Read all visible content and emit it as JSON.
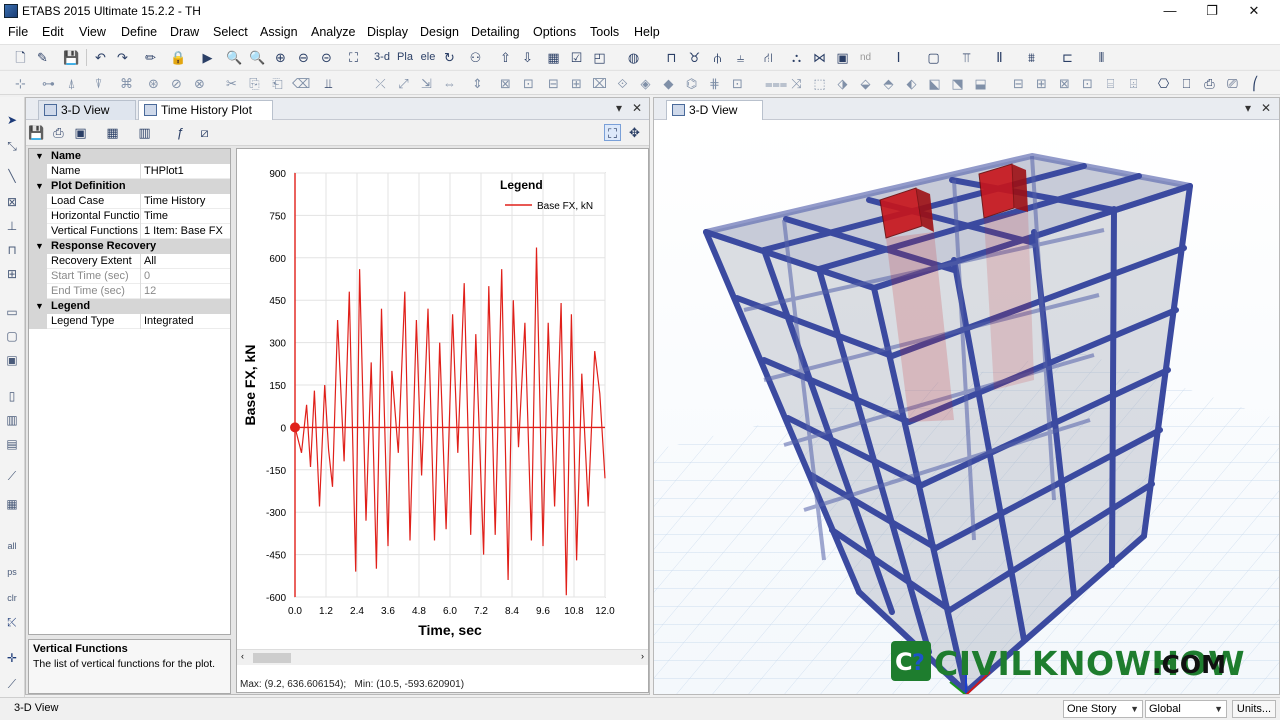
{
  "window": {
    "title": "ETABS 2015 Ultimate 15.2.2 - TH",
    "controls": [
      "—",
      "❐",
      "✕"
    ]
  },
  "menu": [
    "File",
    "Edit",
    "View",
    "Define",
    "Draw",
    "Select",
    "Assign",
    "Analyze",
    "Display",
    "Design",
    "Detailing",
    "Options",
    "Tools",
    "Help"
  ],
  "toolbar": {
    "view_3d_label": "3-d",
    "plan_label": "Plа",
    "elev_label": "elе",
    "nd_label": "nd"
  },
  "left_pane": {
    "tabs": [
      "3-D View",
      "Time History Plot"
    ],
    "active_tab": "Time History Plot",
    "pin": "▾",
    "close": "✕"
  },
  "property_grid": {
    "sections": [
      {
        "name": "Name",
        "rows": [
          {
            "key": "Name",
            "value": "THPlot1",
            "disabled": false
          }
        ]
      },
      {
        "name": "Plot Definition",
        "rows": [
          {
            "key": "Load Case",
            "value": "Time History",
            "disabled": false
          },
          {
            "key": "Horizontal Function",
            "value": "Time",
            "disabled": false
          },
          {
            "key": "Vertical Functions",
            "value": "1 Item: Base FX",
            "disabled": false
          }
        ]
      },
      {
        "name": "Response Recovery",
        "rows": [
          {
            "key": "Recovery Extent",
            "value": "All",
            "disabled": false
          },
          {
            "key": "Start Time (sec)",
            "value": "0",
            "disabled": true
          },
          {
            "key": "End Time (sec)",
            "value": "12",
            "disabled": true
          }
        ]
      },
      {
        "name": "Legend",
        "rows": [
          {
            "key": "Legend Type",
            "value": "Integrated",
            "disabled": false
          }
        ]
      }
    ],
    "help_title": "Vertical Functions",
    "help_text": "The list of vertical functions for the plot."
  },
  "chart_data": {
    "type": "line",
    "title": "",
    "xlabel": "Time,  sec",
    "ylabel": "Base FX,  kN",
    "xlim": [
      0,
      12
    ],
    "ylim": [
      -600,
      900
    ],
    "x_ticks": [
      "0.0",
      "1.2",
      "2.4",
      "3.6",
      "4.8",
      "6.0",
      "7.2",
      "8.4",
      "9.6",
      "10.8",
      "12.0"
    ],
    "y_ticks": [
      "900",
      "750",
      "600",
      "450",
      "300",
      "150",
      "0",
      "-150",
      "-300",
      "-450",
      "-600"
    ],
    "grid": true,
    "legend_title": "Legend",
    "legend_position": "top-right",
    "series": [
      {
        "name": "Base FX, kN",
        "color": "#e0201a",
        "x": [
          0,
          0.25,
          0.45,
          0.6,
          0.75,
          0.95,
          1.15,
          1.3,
          1.45,
          1.65,
          1.9,
          2.1,
          2.35,
          2.5,
          2.75,
          2.95,
          3.15,
          3.35,
          3.6,
          3.75,
          4.0,
          4.25,
          4.45,
          4.7,
          4.9,
          5.15,
          5.4,
          5.6,
          5.85,
          6.1,
          6.3,
          6.55,
          6.8,
          7.0,
          7.3,
          7.5,
          7.75,
          8.0,
          8.25,
          8.45,
          8.65,
          8.9,
          9.15,
          9.35,
          9.6,
          9.8,
          10.05,
          10.3,
          10.5,
          10.7,
          10.9,
          11.1,
          11.35,
          11.6,
          11.8,
          12.0
        ],
        "y": [
          0,
          -90,
          80,
          -140,
          130,
          -280,
          150,
          -80,
          -210,
          380,
          -120,
          480,
          -510,
          560,
          -330,
          230,
          -500,
          420,
          -420,
          200,
          -90,
          480,
          -400,
          380,
          -170,
          420,
          -400,
          300,
          -360,
          400,
          -90,
          510,
          -380,
          330,
          -450,
          500,
          -380,
          560,
          -540,
          450,
          -70,
          370,
          -400,
          636.6,
          -420,
          370,
          -280,
          440,
          -593.6,
          400,
          -470,
          190,
          -280,
          270,
          120,
          -180
        ]
      }
    ],
    "max_label": "Max: (9.2, 636.606154);",
    "min_label": "Min: (10.5, -593.620901)"
  },
  "right_pane": {
    "tab": "3-D View",
    "pin": "▾",
    "close": "✕"
  },
  "status": {
    "left": "3-D View",
    "story_mode": "One Story",
    "coord_system": "Global",
    "units_button": "Units..."
  },
  "watermark": {
    "text": "CIVILKNOWHOW",
    "suffix": ".COM",
    "color": "#1e7d2e"
  }
}
